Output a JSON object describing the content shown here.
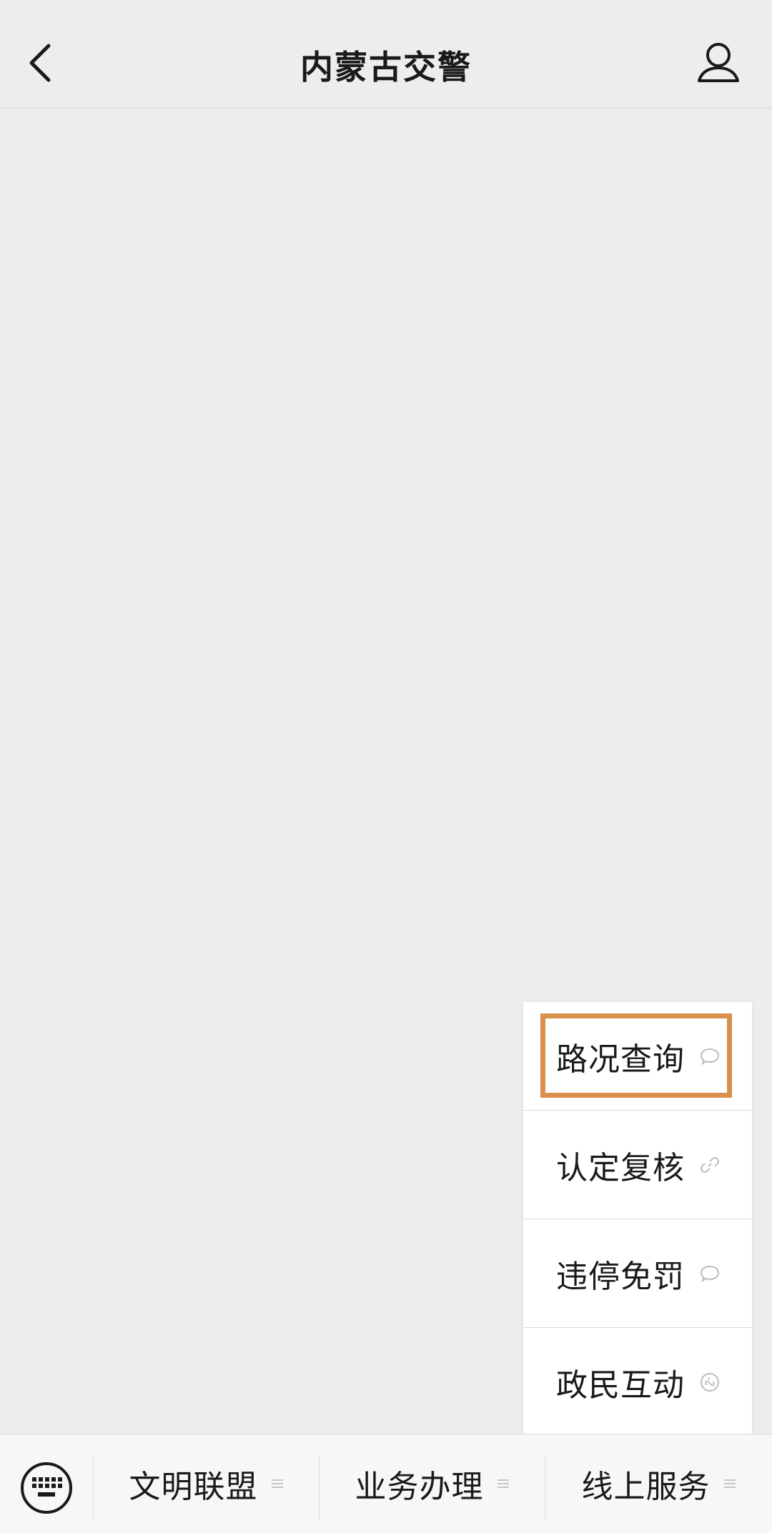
{
  "header": {
    "title": "内蒙古交警",
    "back_icon": "chevron-left-icon",
    "profile_icon": "person-icon"
  },
  "submenu": {
    "items": [
      {
        "label": "路况查询",
        "icon": "chat-bubble-icon",
        "highlighted": true
      },
      {
        "label": "认定复核",
        "icon": "link-icon",
        "highlighted": false
      },
      {
        "label": "违停免罚",
        "icon": "chat-bubble-icon",
        "highlighted": false
      },
      {
        "label": "政民互动",
        "icon": "mini-program-icon",
        "highlighted": false
      }
    ],
    "highlight_color": "#d9904d"
  },
  "menubar": {
    "keyboard_icon": "keyboard-icon",
    "items": [
      {
        "label": "文明联盟",
        "icon": "menu-lines-icon"
      },
      {
        "label": "业务办理",
        "icon": "menu-lines-icon"
      },
      {
        "label": "线上服务",
        "icon": "menu-lines-icon"
      }
    ]
  },
  "colors": {
    "background": "#ededed",
    "menubar_bg": "#f7f7f7",
    "text": "#1a1a1a"
  }
}
